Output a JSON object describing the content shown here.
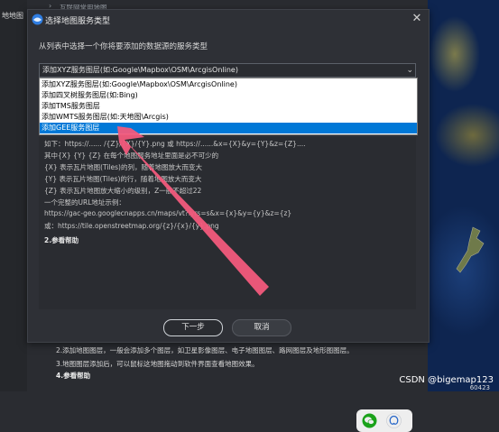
{
  "background": {
    "left_label": "地地图",
    "breadcrumb": "互联网常用地图",
    "bottom_lines": [
      "2.添加地图图层，一般会添加多个图层，如卫星影像图层、电子地图图层、路网图层及地形图图层。",
      "3.地图图层添加后，可以鼠标这地图拖动到软件界面查看地图效果。",
      "4.参看帮助"
    ],
    "map_tag": "60423",
    "watermark": "CSDN @bigemap123"
  },
  "dialog": {
    "title": "选择地图服务类型",
    "close_label": "✕",
    "instruction": "从列表中选择一个你将要添加的数据源的服务类型",
    "select": {
      "value": "添加XYZ服务图层(如:Google\\Mapbox\\OSM\\ArcgisOnline)",
      "options": [
        "添加XYZ服务图层(如:Google\\Mapbox\\OSM\\ArcgisOnline)",
        "添加四叉树服务图层(如:Bing)",
        "添加TMS服务图层",
        "添加WMTS服务图层(如:天地图\\Arcgis)",
        "添加GEE服务图层"
      ],
      "selected_index": 4
    },
    "help_lines": [
      "如下：https://...... /{Z}/{X}/{Y}.png 或 https://......&x={X}&y={Y}&z={Z}....",
      "其中{X} {Y} {Z} 在每个地图服务地址里面是必不可少的",
      "{X} 表示瓦片地图(Tiles)的列，随着地图放大而变大",
      "{Y} 表示瓦片地图(Tiles)的行，随着地图放大而变大",
      "{Z} 表示瓦片地图放大缩小的级别，Z一般不超过22",
      "一个完整的URL地址示例：",
      "https://gac-geo.googlecnapps.cn/maps/vt?lyrs=s&x={x}&y={y}&z={z}",
      "或：https://tile.openstreetmap.org/{z}/{x}/{y}.png",
      "2.参看帮助"
    ],
    "buttons": {
      "next": "下一步",
      "cancel": "取消"
    }
  },
  "colors": {
    "dialog_bg": "#2e3036",
    "selected_item": "#0078d7",
    "annotation_arrow": "#f25a7c",
    "wechat_green": "#1aad19",
    "qq_blue": "#2b6fd6"
  }
}
